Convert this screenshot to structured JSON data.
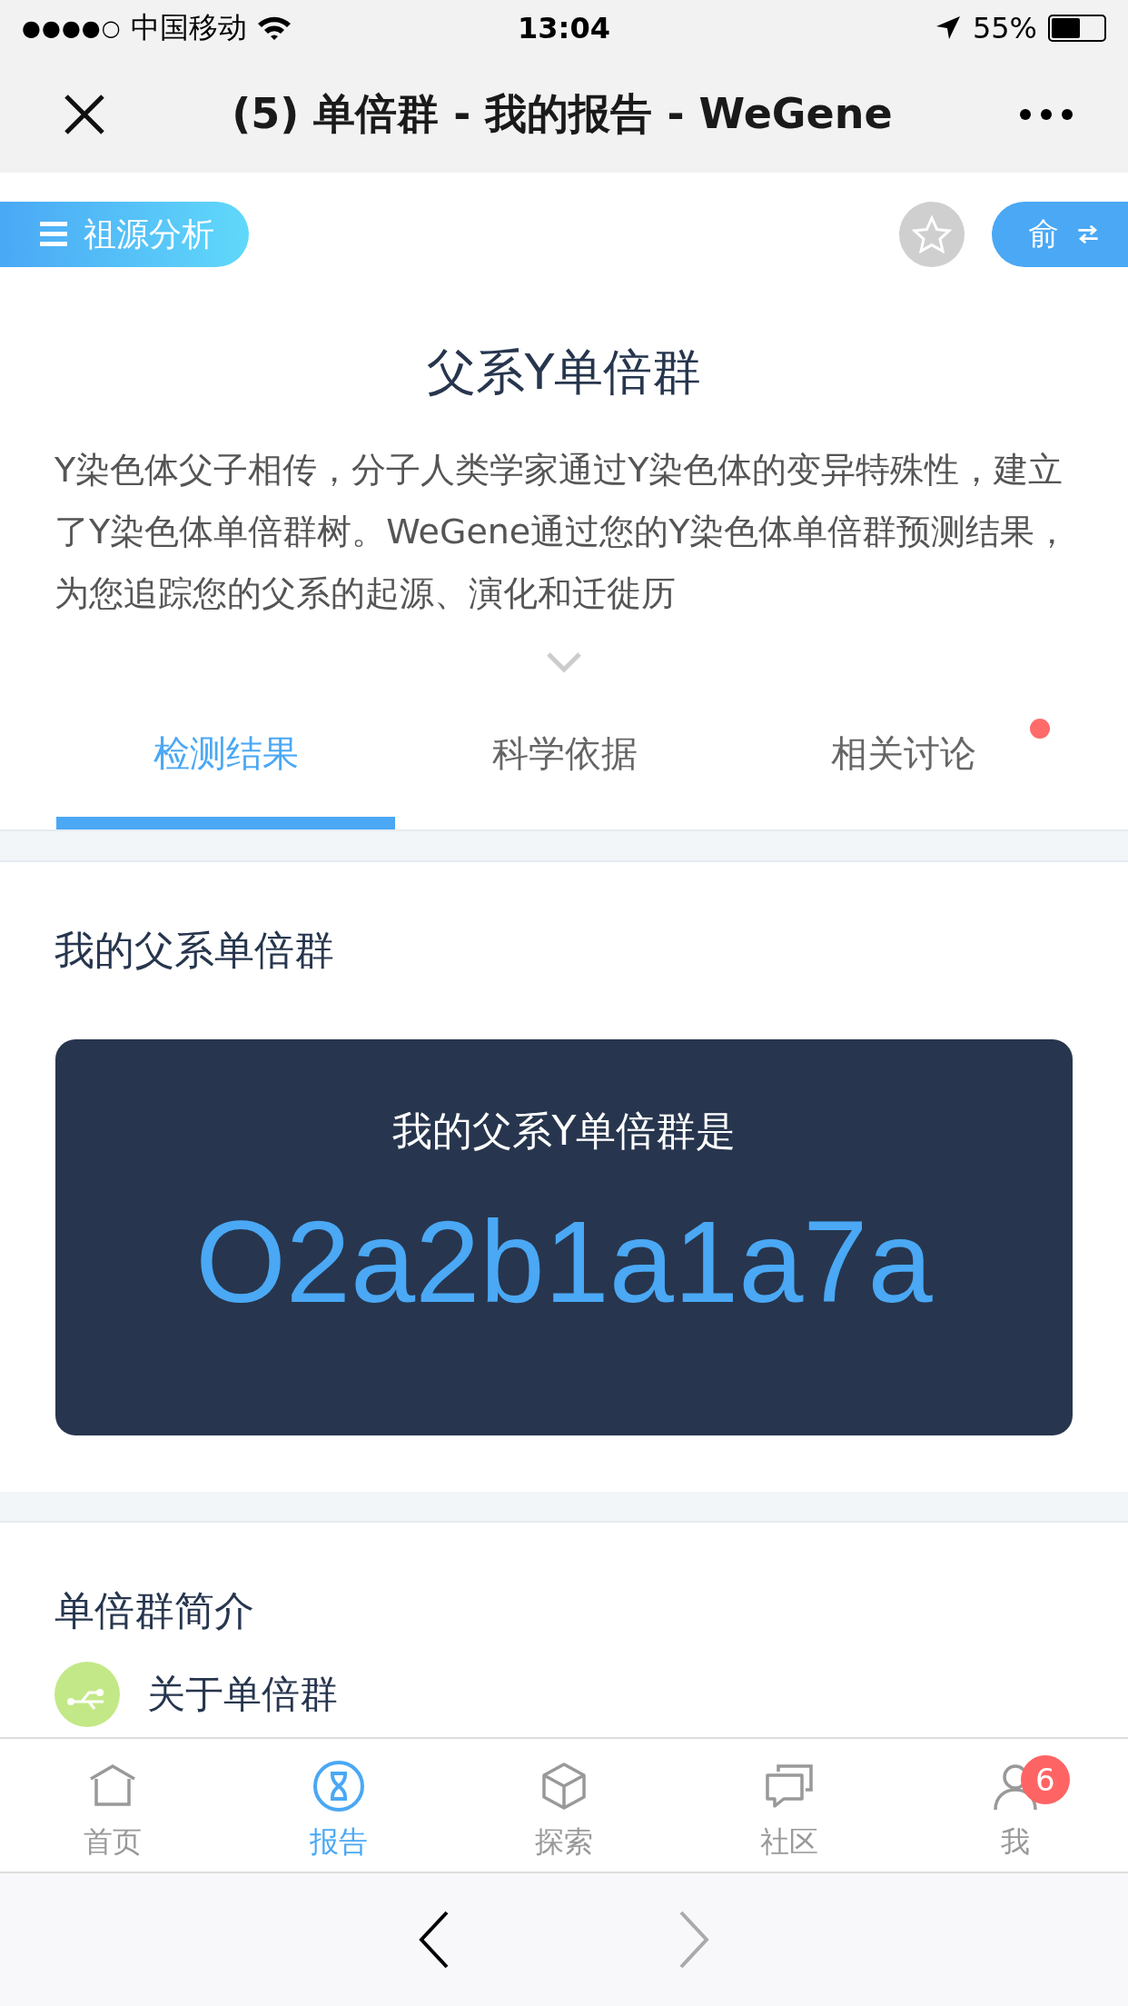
{
  "status_bar": {
    "signal": "●●●●○",
    "carrier": "中国移动",
    "time": "13:04",
    "battery": "55%"
  },
  "nav_bar": {
    "title": "(5) 单倍群 - 我的报告 - WeGene"
  },
  "toolbar": {
    "menu_label": "祖源分析",
    "switch_label": "俞",
    "starred": false
  },
  "header": {
    "title": "父系Y单倍群",
    "description": "Y染色体父子相传，分子人类学家通过Y染色体的变异特殊性，建立了Y染色体单倍群树。WeGene通过您的Y染色体单倍群预测结果，为您追踪您的父系的起源、演化和迁徙历"
  },
  "tabs": [
    {
      "label": "检测结果",
      "selected": true,
      "dot": false
    },
    {
      "label": "科学依据",
      "selected": false,
      "dot": false
    },
    {
      "label": "相关讨论",
      "selected": false,
      "dot": true
    }
  ],
  "result": {
    "heading": "我的父系单倍群",
    "card_label": "我的父系Y单倍群是",
    "haplogroup": "O2a2b1a1a7a"
  },
  "intro": {
    "heading": "单倍群简介",
    "items": [
      {
        "label": "关于单倍群"
      }
    ]
  },
  "bottom_nav": [
    {
      "kind": "home",
      "label": "首页",
      "selected": false
    },
    {
      "kind": "report",
      "label": "报告",
      "selected": true
    },
    {
      "kind": "explore",
      "label": "探索",
      "selected": false
    },
    {
      "kind": "community",
      "label": "社区",
      "selected": false
    },
    {
      "kind": "me",
      "label": "我",
      "selected": false,
      "badge": "6"
    }
  ],
  "browser_bar": {
    "back_disabled": false,
    "forward_disabled": true
  }
}
